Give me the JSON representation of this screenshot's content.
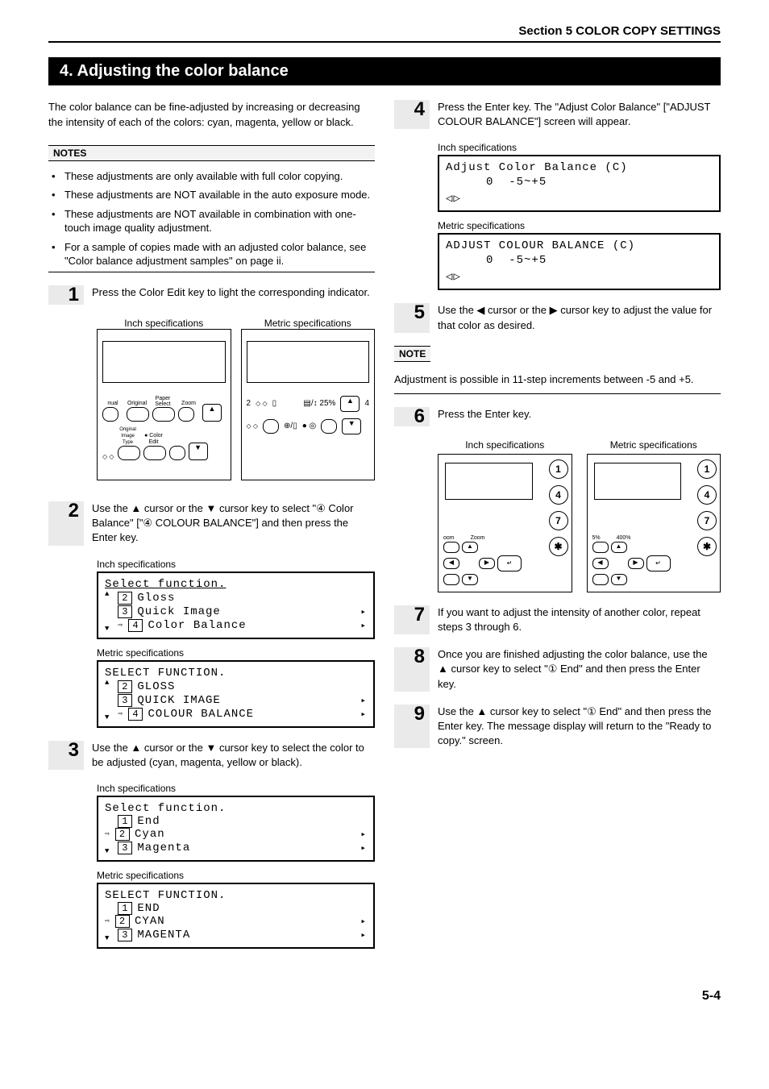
{
  "section_header": "Section 5  COLOR COPY SETTINGS",
  "title": "4.   Adjusting the color balance",
  "intro": "The color balance can be fine-adjusted by increasing or decreasing the intensity of each of the colors: cyan, magenta, yellow or black.",
  "notes_label": "NOTES",
  "note_label": "NOTE",
  "notes": [
    "These adjustments are only available with full color copying.",
    "These adjustments are NOT available in the auto exposure mode.",
    "These adjustments are NOT available in combination with one-touch image quality adjustment.",
    "For a sample of copies made with an adjusted color balance, see \"Color balance adjustment samples\" on page ii."
  ],
  "inch_label": "Inch specifications",
  "metric_label": "Metric specifications",
  "step1": {
    "n": "1",
    "txt": "Press the Color Edit key to light the corresponding indicator."
  },
  "panel": {
    "nual": "nual",
    "original": "Original",
    "paper": "Paper Select",
    "zoom": "Zoom",
    "origtype": "Original Image Type",
    "color": "Color Edit",
    "pct": "25%"
  },
  "step2": {
    "n": "2",
    "txt": "Use the ▲ cursor or the ▼ cursor key to select \"④ Color Balance\" [\"④ COLOUR BALANCE\"] and then press the Enter key."
  },
  "lcd2i": {
    "hdr": "Select function.",
    "l2": "Gloss",
    "l3": "Quick Image",
    "l4": "Color Balance"
  },
  "lcd2m": {
    "hdr": "SELECT FUNCTION.",
    "l2": "GLOSS",
    "l3": "QUICK IMAGE",
    "l4": "COLOUR BALANCE"
  },
  "step3": {
    "n": "3",
    "txt": "Use the ▲ cursor or the ▼ cursor key to select the color to be adjusted (cyan, magenta, yellow or black)."
  },
  "lcd3i": {
    "hdr": "Select function.",
    "l1": "End",
    "l2": "Cyan",
    "l3": "Magenta"
  },
  "lcd3m": {
    "hdr": "SELECT FUNCTION.",
    "l1": "END",
    "l2": "CYAN",
    "l3": "MAGENTA"
  },
  "step4": {
    "n": "4",
    "txt": "Press the Enter key. The \"Adjust Color Balance\" [\"ADJUST COLOUR BALANCE\"]  screen will appear."
  },
  "lcd4i": {
    "hdr": "Adjust Color Balance (C)",
    "val": "0",
    "range": "-5~+5"
  },
  "lcd4m": {
    "hdr": "ADJUST COLOUR BALANCE (C)",
    "val": "0",
    "range": "-5~+5"
  },
  "step5": {
    "n": "5",
    "txt": "Use the ◀ cursor or the ▶ cursor key to adjust the value for that color as desired."
  },
  "note5": "Adjustment is possible in 11-step increments between -5 and +5.",
  "step6": {
    "n": "6",
    "txt": "Press the Enter key."
  },
  "mini": {
    "zoom_lbl": "Zoom",
    "pct_lo": "5%",
    "pct_hi": "400%",
    "s1": "1",
    "s4": "4",
    "s7": "7",
    "sstar": "✱"
  },
  "step7": {
    "n": "7",
    "txt": "If you want to adjust the intensity of another color, repeat steps 3 through 6."
  },
  "step8": {
    "n": "8",
    "txt": "Once you are finished adjusting the color balance, use the ▲ cursor key to select \"① End\" and then press the Enter key."
  },
  "step9": {
    "n": "9",
    "txt": "Use the ▲ cursor key to select \"① End\" and then press the Enter key. The message display will return to the \"Ready to copy.\" screen."
  },
  "page_num": "5-4"
}
